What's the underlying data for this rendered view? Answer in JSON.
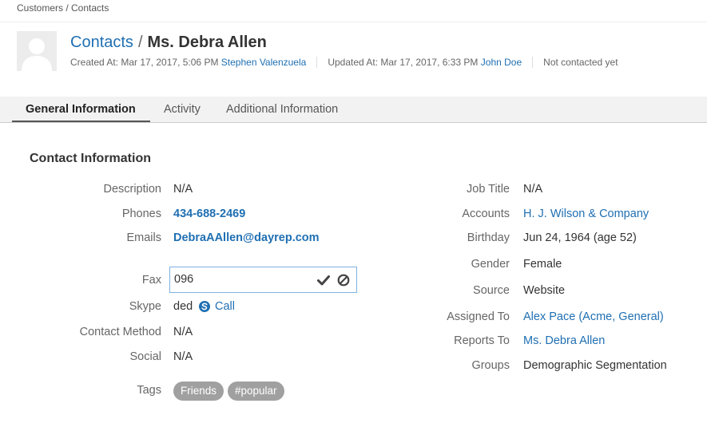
{
  "breadcrumb": {
    "text": "Customers / Contacts"
  },
  "header": {
    "title_link": "Contacts",
    "separator": "/",
    "title_name": "Ms. Debra Allen",
    "created_prefix": "Created At: Mar 17, 2017, 5:06 PM",
    "created_by": "Stephen Valenzuela",
    "updated_prefix": "Updated At: Mar 17, 2017, 6:33 PM",
    "updated_by": "John Doe",
    "contact_status": "Not contacted yet"
  },
  "tabs": [
    {
      "label": "General Information",
      "active": true
    },
    {
      "label": "Activity",
      "active": false
    },
    {
      "label": "Additional Information",
      "active": false
    }
  ],
  "section": {
    "title": "Contact Information"
  },
  "left_fields": {
    "description": {
      "label": "Description",
      "value": "N/A"
    },
    "phones": {
      "label": "Phones",
      "value": "434-688-2469"
    },
    "emails": {
      "label": "Emails",
      "value": "DebraAAllen@dayrep.com"
    },
    "fax": {
      "label": "Fax",
      "value": "096"
    },
    "skype": {
      "label": "Skype",
      "value": "ded",
      "call_label": "Call"
    },
    "contact_method": {
      "label": "Contact Method",
      "value": "N/A"
    },
    "social": {
      "label": "Social",
      "value": "N/A"
    },
    "tags": {
      "label": "Tags",
      "items": [
        "Friends",
        "#popular"
      ]
    }
  },
  "right_fields": {
    "job_title": {
      "label": "Job Title",
      "value": "N/A"
    },
    "accounts": {
      "label": "Accounts",
      "value": "H. J. Wilson & Company"
    },
    "birthday": {
      "label": "Birthday",
      "value": "Jun 24, 1964 (age 52)"
    },
    "gender": {
      "label": "Gender",
      "value": "Female"
    },
    "source": {
      "label": "Source",
      "value": "Website"
    },
    "assigned_to": {
      "label": "Assigned To",
      "user": "Alex Pace",
      "open_paren": "(",
      "org": "Acme, General",
      "close_paren": ")"
    },
    "reports_to": {
      "label": "Reports To",
      "value": "Ms. Debra Allen"
    },
    "groups": {
      "label": "Groups",
      "value": "Demographic Segmentation"
    }
  },
  "icons": {
    "avatar": "user-avatar-placeholder",
    "save": "checkmark-icon",
    "cancel": "cancel-circle-icon",
    "skype": "skype-icon"
  },
  "colors": {
    "link": "#1f6fb2",
    "tag_bg": "#a0a0a0",
    "input_border": "#7fb2e0"
  }
}
